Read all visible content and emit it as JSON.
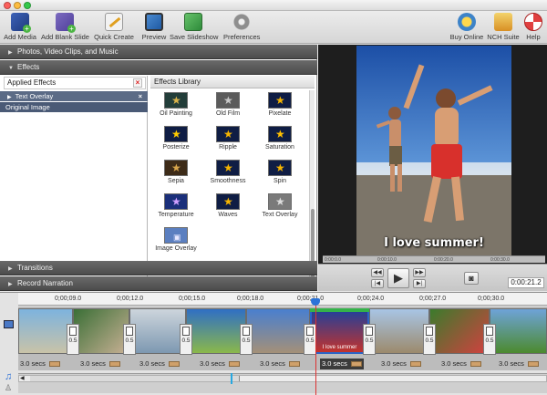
{
  "toolbar": {
    "add_media": "Add Media",
    "add_blank_slide": "Add Blank Slide",
    "quick_create": "Quick Create",
    "preview": "Preview",
    "save_slideshow": "Save Slideshow",
    "preferences": "Preferences",
    "buy_online": "Buy Online",
    "nch_suite": "NCH Suite",
    "help": "Help"
  },
  "sections": {
    "photos": "Photos, Video Clips, and Music",
    "effects": "Effects",
    "transitions": "Transitions",
    "record_narration": "Record Narration"
  },
  "applied_effects": {
    "title": "Applied Effects",
    "delete_icon": "×",
    "items": [
      "Text Overlay",
      "Original Image"
    ]
  },
  "effects_library": {
    "title": "Effects Library",
    "items": [
      "Oil Painting",
      "Old Film",
      "Pixelate",
      "Posterize",
      "Ripple",
      "Saturation",
      "Sepia",
      "Smoothness",
      "Spin",
      "Temperature",
      "Waves",
      "Text Overlay",
      "Image Overlay"
    ]
  },
  "preview": {
    "caption": "I love summer!",
    "timecode": "0:00:21.2",
    "ruler": [
      "0:00:0.0",
      "0:00:10.0",
      "0:00:20.0",
      "0:00:30.0"
    ]
  },
  "timeline": {
    "ruler": [
      "0;00;09.0",
      "0;00;12.0",
      "0;00;15.0",
      "0;00;18.0",
      "0;00;21.0",
      "0;00;24.0",
      "0;00;27.0",
      "0;00;30.0"
    ],
    "transition_label": "0.5",
    "clip_duration": "3.0 secs",
    "clip_overlay_text": "I love summer"
  },
  "colors": {
    "section_bg": "#555555",
    "selection": "#5b6b86",
    "playhead": "#d33333"
  }
}
